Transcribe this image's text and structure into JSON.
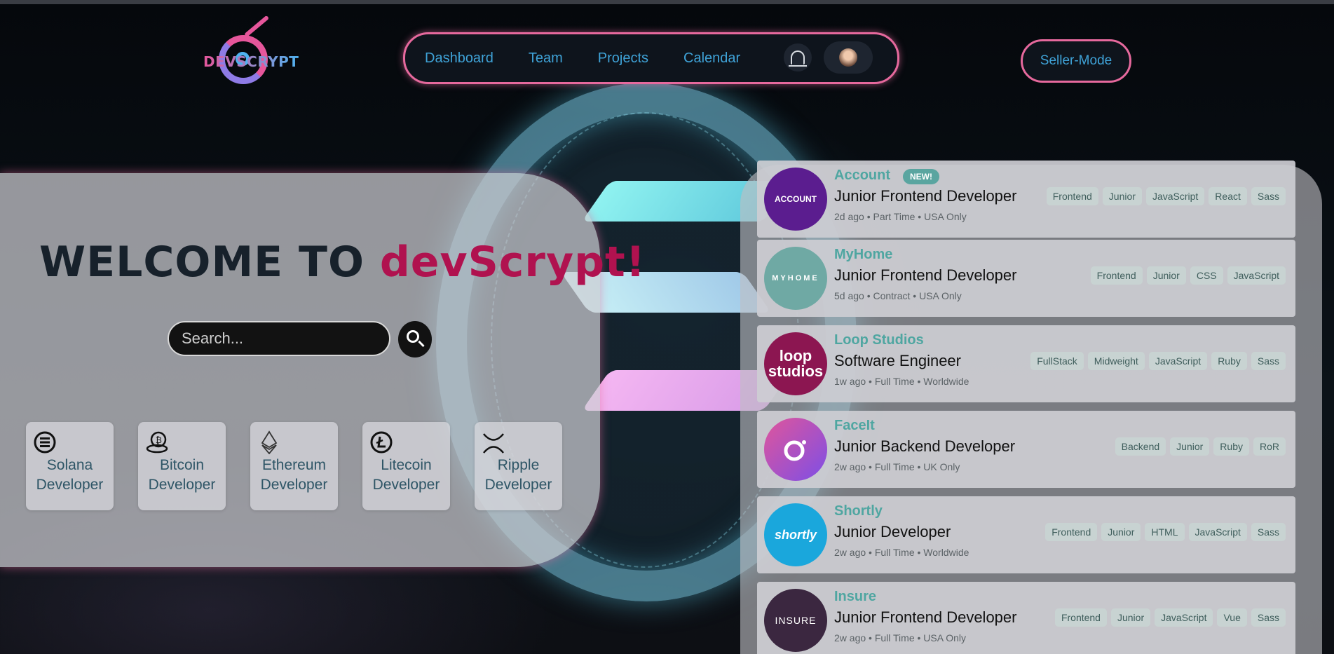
{
  "brand": {
    "logo_text": "DEVSCRYPT"
  },
  "nav": {
    "links": [
      "Dashboard",
      "Team",
      "Projects",
      "Calendar"
    ]
  },
  "seller_button": "Seller-Mode",
  "hero": {
    "title_prefix": "WELCOME TO ",
    "title_brand": "devScrypt!",
    "search_placeholder": "Search...",
    "categories": [
      {
        "icon": "solana-icon",
        "line1": "Solana",
        "line2": "Developer"
      },
      {
        "icon": "bitcoin-icon",
        "line1": "Bitcoin",
        "line2": "Developer"
      },
      {
        "icon": "ethereum-icon",
        "line1": "Ethereum",
        "line2": "Developer"
      },
      {
        "icon": "litecoin-icon",
        "line1": "Litecoin",
        "line2": "Developer"
      },
      {
        "icon": "ripple-icon",
        "line1": "Ripple",
        "line2": "Developer"
      }
    ]
  },
  "jobs": [
    {
      "company": "Account",
      "new_badge": "NEW!",
      "logo_text": "ACCOUNT",
      "logo_color": "#5b1d8f",
      "position": "Junior Frontend Developer",
      "meta": "2d ago • Part Time • USA Only",
      "tags": [
        "Frontend",
        "Junior",
        "JavaScript",
        "React",
        "Sass"
      ]
    },
    {
      "company": "MyHome",
      "logo_text": "MYHOME",
      "logo_color": "#6fa9a4",
      "position": "Junior Frontend Developer",
      "meta": "5d ago • Contract • USA Only",
      "tags": [
        "Frontend",
        "Junior",
        "CSS",
        "JavaScript"
      ]
    },
    {
      "company": "Loop Studios",
      "logo_text": "loop studios",
      "logo_color": "#8c1651",
      "position": "Software Engineer",
      "meta": "1w ago • Full Time • Worldwide",
      "tags": [
        "FullStack",
        "Midweight",
        "JavaScript",
        "Ruby",
        "Sass"
      ]
    },
    {
      "company": "FaceIt",
      "logo_text": "",
      "logo_color": "#b04fd8",
      "position": "Junior Backend Developer",
      "meta": "2w ago • Full Time • UK Only",
      "tags": [
        "Backend",
        "Junior",
        "Ruby",
        "RoR"
      ]
    },
    {
      "company": "Shortly",
      "logo_text": "shortly",
      "logo_color": "#1aa7dc",
      "position": "Junior Developer",
      "meta": "2w ago • Full Time • Worldwide",
      "tags": [
        "Frontend",
        "Junior",
        "HTML",
        "JavaScript",
        "Sass"
      ]
    },
    {
      "company": "Insure",
      "logo_text": "INSURE",
      "logo_color": "#3b2740",
      "position": "Junior Frontend Developer",
      "meta": "2w ago • Full Time • USA Only",
      "tags": [
        "Frontend",
        "Junior",
        "JavaScript",
        "Vue",
        "Sass"
      ]
    }
  ]
}
